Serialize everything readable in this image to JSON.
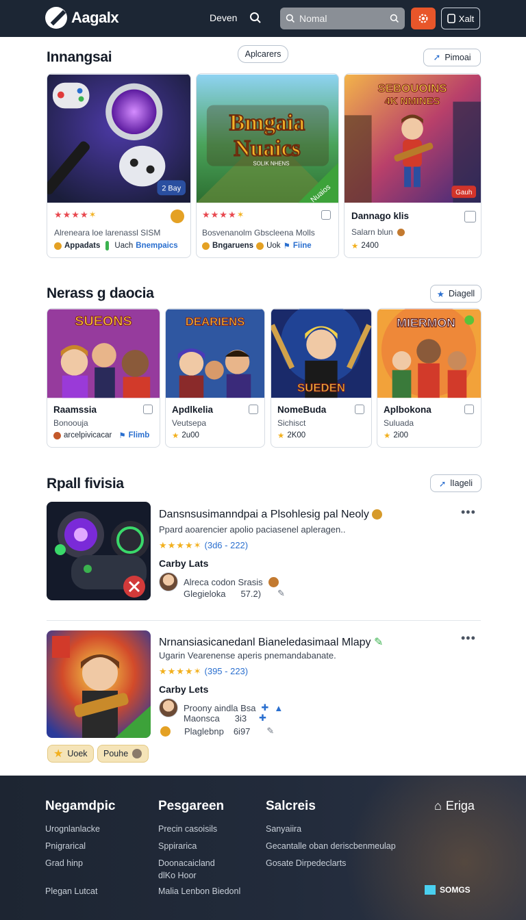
{
  "header": {
    "brand": "Aagalx",
    "nav_link": "Deven",
    "search_placeholder": "Nomal",
    "account_label": "Xalt",
    "colors": {
      "bar": "#1c2634",
      "accent": "#e8562a"
    }
  },
  "featured": {
    "title": "Innangsai",
    "center_pill": "Aplcarers",
    "right_button": "Pimoai",
    "cards": [
      {
        "art_label": "2 Bay",
        "title": "",
        "desc": "Alreneara loe larenassl SISM",
        "meta_left": "Appadats",
        "meta_mid": "Uach",
        "meta_right": "Bnempaics",
        "stars": 5
      },
      {
        "art_line1": "Bmgaia",
        "art_line2": "Nuaics",
        "art_line3": "SOLIK NHENS",
        "art_label": "Nuaios",
        "title": "",
        "desc": "Bosvenanolm Gbscleena Molls",
        "meta_left": "Bngaruens",
        "meta_mid": "Uok",
        "meta_right": "Fiine",
        "stars": 5
      },
      {
        "art_line1": "SEBOUOINS",
        "art_line2": "4K NMINES",
        "art_label": "Gauh",
        "title": "Dannago klis",
        "desc": "Salarn blun",
        "meta_right": "2400",
        "stars": 0
      }
    ]
  },
  "new_section": {
    "title": "Nerass g daocia",
    "button": "Diagell",
    "cards": [
      {
        "art_title": "SUEONS",
        "title": "Raamssia",
        "sub": "Bonoouja",
        "meta": "arcelpivicacar",
        "meta_link": "Flimb"
      },
      {
        "art_title": "DEARIENS",
        "title": "Apdlkelia",
        "sub": "Veutsepa",
        "meta": "2u00"
      },
      {
        "art_title": "SUEDEN",
        "title": "NomeBuda",
        "sub": "Sichisct",
        "meta": "2K00"
      },
      {
        "art_title": "MIERMON",
        "title": "Aplbokona",
        "sub": "Suluada",
        "meta": "2i00"
      }
    ]
  },
  "popular": {
    "title": "Rpall fivisia",
    "button": "lIageli",
    "items": [
      {
        "title": "Dansnsusimanndpai a Plsohlesig pal Neoly",
        "desc": "Ppard aoarencier apolio paciasenel apleragen..",
        "rating": "(3d6 - 222)",
        "sub": "Carby Lats",
        "reviewers": [
          {
            "name": "Alreca codon Srasis"
          },
          {
            "name": "Glegieloka",
            "value": "57.2)"
          }
        ]
      },
      {
        "title": "Nrnansiasicanedanl Bianeledasimaal Mlapy",
        "desc": "Ugarin Vearenense aperis pnemandabanate.",
        "rating": "(395 - 223)",
        "sub": "Carby Lets",
        "reviewers": [
          {
            "name": "Proony aindla Bsa"
          },
          {
            "name": "Maonsca",
            "value": "3i3"
          },
          {
            "name": "Plaglebnp",
            "value": "6i97"
          }
        ],
        "tags": [
          "Uoek",
          "Pouhe"
        ]
      }
    ]
  },
  "footer": {
    "columns": [
      {
        "heading": "Negamdpic",
        "links": [
          "Urognlanlacke",
          "Pnigrarical",
          "Grad hinp",
          "Plegan Lutcat"
        ]
      },
      {
        "heading": "Pesgareen",
        "links": [
          "Precin casoisils",
          "Sppirarica",
          "Doonacaicland",
          "dlKo Hoor",
          "Malia Lenbon Biedonl"
        ]
      },
      {
        "heading": "Salcreis",
        "links": [
          "Sanyaiira",
          "Gecantalle oban deriscbenmeulap",
          "Gosate Dirpedeclarts"
        ]
      }
    ],
    "right_label": "Eriga",
    "right_brand": "SOMGS"
  }
}
